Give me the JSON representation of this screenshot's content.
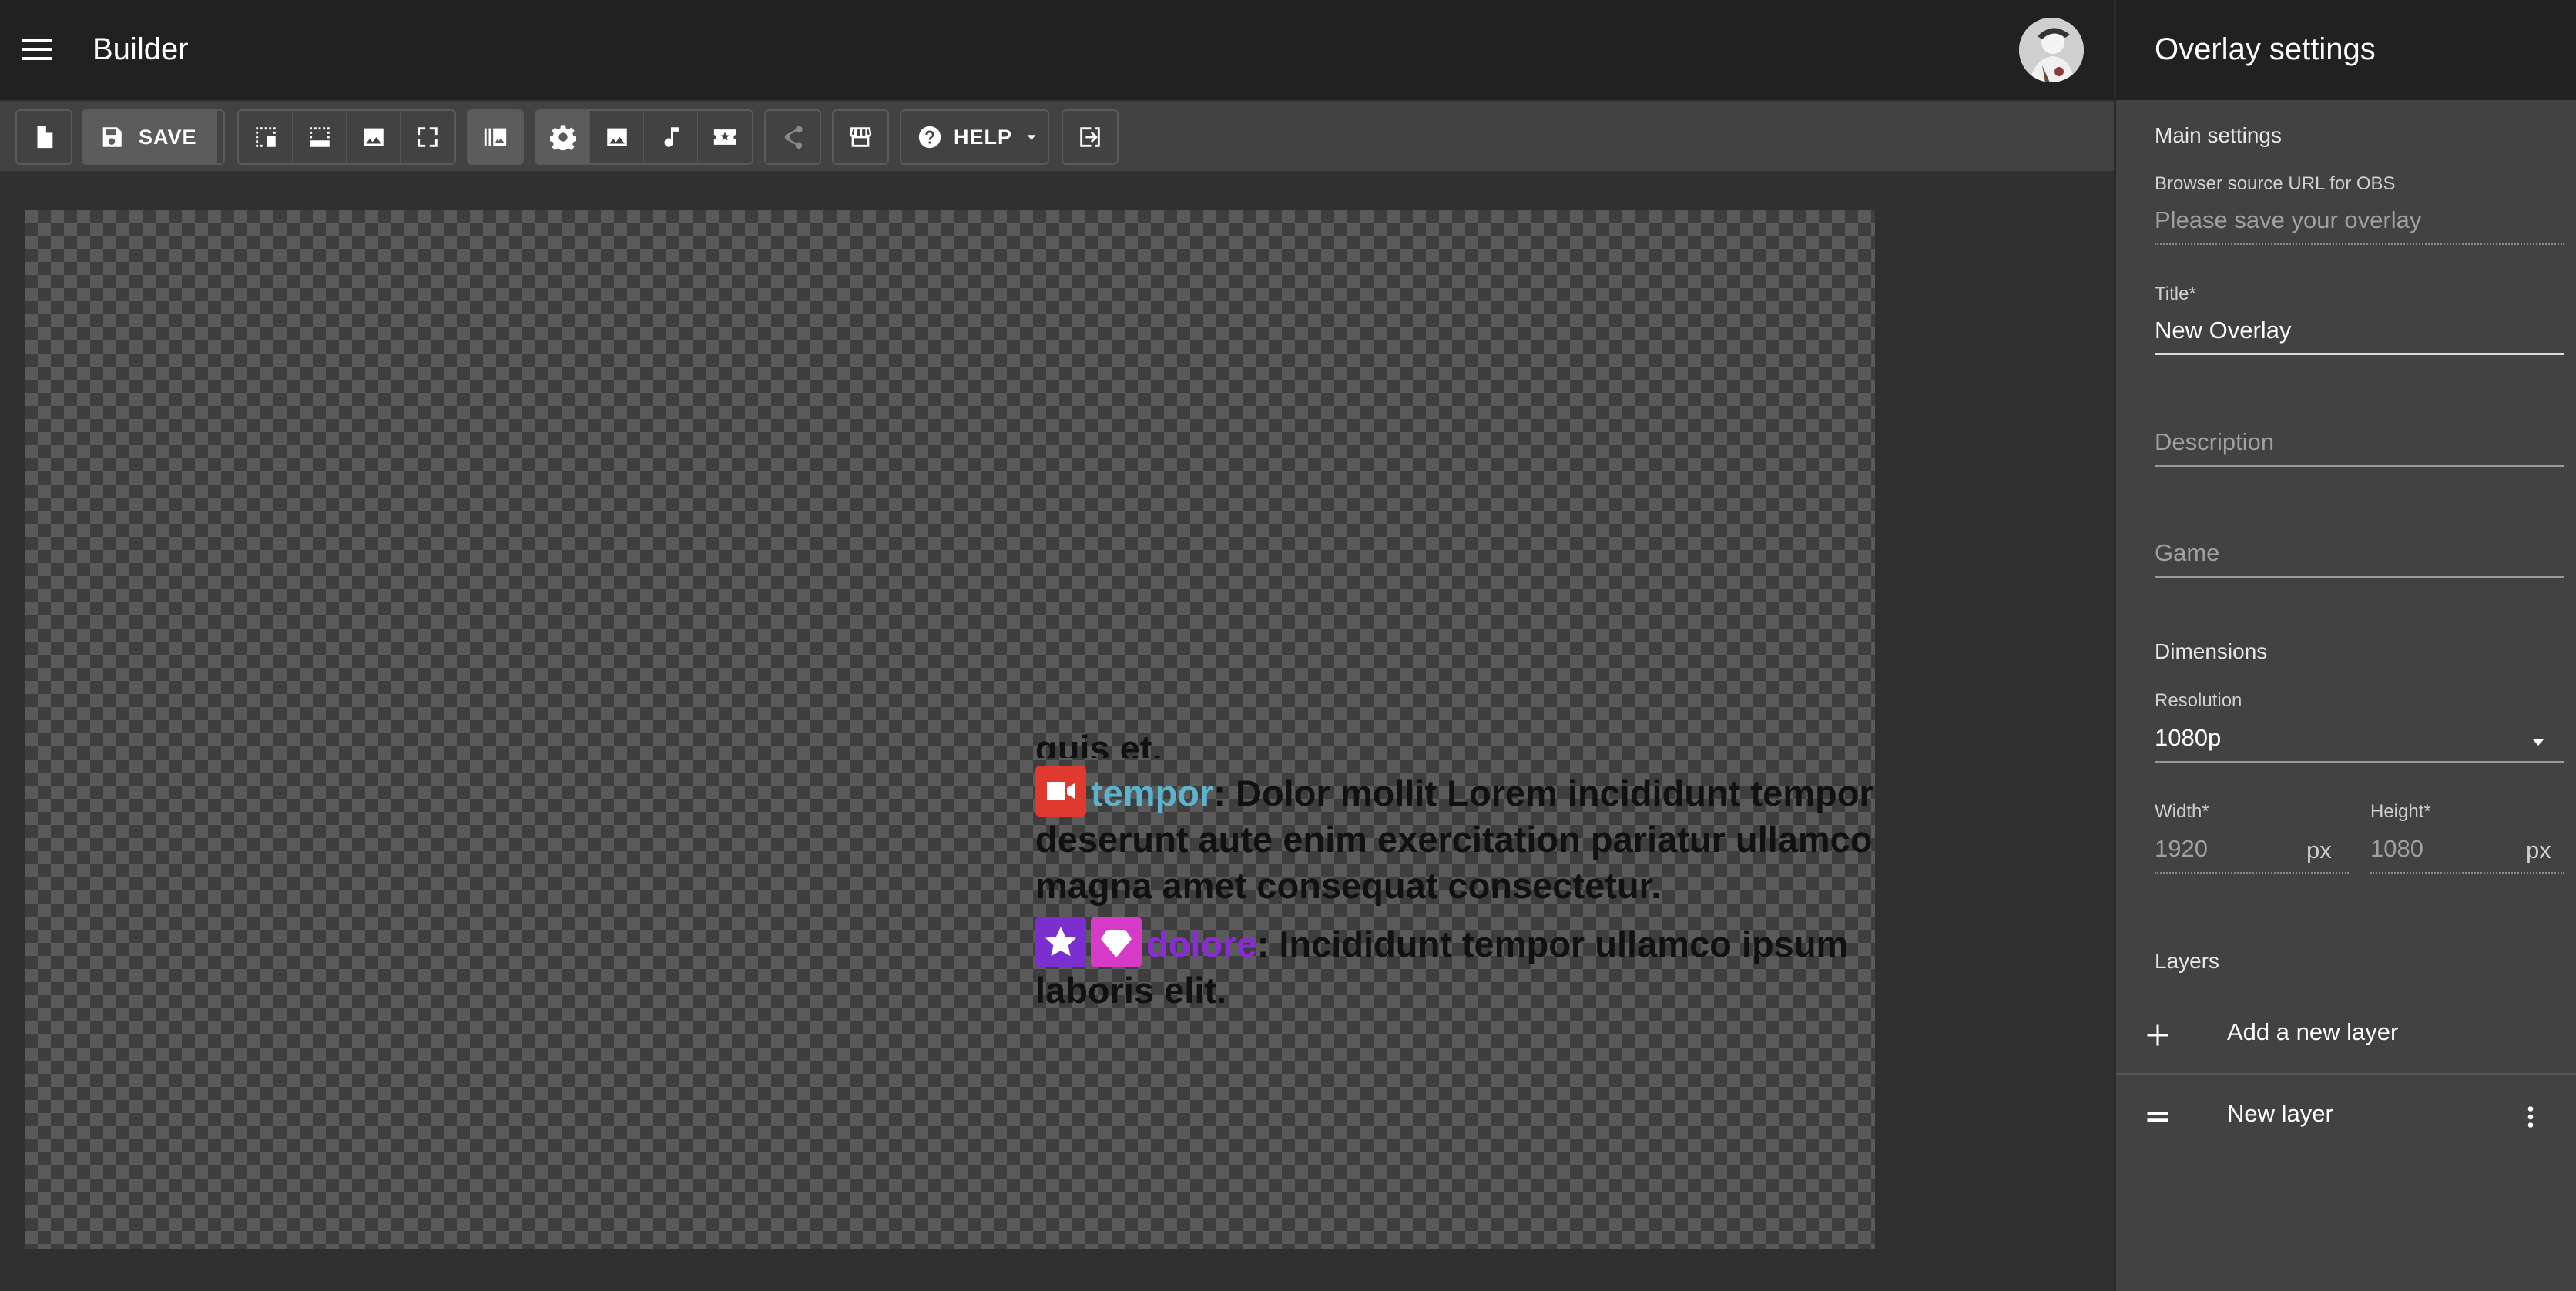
{
  "app": {
    "title": "Builder"
  },
  "toolbar": {
    "save_label": "SAVE",
    "help_label": "HELP"
  },
  "canvas": {
    "chat": {
      "partial_line": "quis et.",
      "messages": [
        {
          "name": "tempor",
          "name_color": "#5bb3ce",
          "badges": [
            "camera-icon"
          ],
          "badge_colors": [
            "#e03a2f"
          ],
          "text": ": Dolor mollit Lorem incididunt tempor deserunt aute enim exercitation pariatur ullamco magna amet consequat consectetur."
        },
        {
          "name": "dolore",
          "name_color": "#8a2bd6",
          "badges": [
            "star-icon",
            "gem-icon"
          ],
          "badge_colors": [
            "#7b2fcf",
            "#d63bc8"
          ],
          "text": ": Incididunt tempor ullamco ipsum laboris elit."
        }
      ]
    }
  },
  "panel": {
    "title": "Overlay settings",
    "main_settings_heading": "Main settings",
    "browser_source_label": "Browser source URL for OBS",
    "browser_source_placeholder": "Please save your overlay",
    "title_label": "Title*",
    "title_value": "New Overlay",
    "description_placeholder": "Description",
    "game_placeholder": "Game",
    "dimensions_heading": "Dimensions",
    "resolution_label": "Resolution",
    "resolution_value": "1080p",
    "width_label": "Width*",
    "width_value": "1920",
    "width_unit": "px",
    "height_label": "Height*",
    "height_value": "1080",
    "height_unit": "px",
    "layers_heading": "Layers",
    "add_layer_label": "Add a new layer",
    "layers": [
      {
        "label": "New layer"
      }
    ]
  }
}
